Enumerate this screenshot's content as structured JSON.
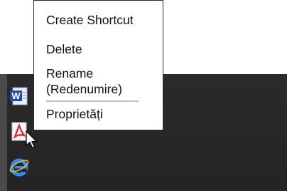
{
  "context_menu": {
    "items": [
      {
        "label": "Create Shortcut"
      },
      {
        "label": "Delete"
      },
      {
        "label": "Rename\n(Redenumire)"
      },
      {
        "label": "Proprietăți"
      }
    ]
  },
  "desktop": {
    "icons": [
      {
        "icon": "word-document-icon"
      },
      {
        "icon": "pdf-document-icon"
      },
      {
        "icon": "internet-explorer-icon"
      }
    ]
  },
  "colors": {
    "desktop_background": "#272727",
    "menu_background": "#ffffff",
    "menu_border": "#2b2b2b",
    "menu_text": "#111111",
    "separator": "#bfbfbf"
  }
}
